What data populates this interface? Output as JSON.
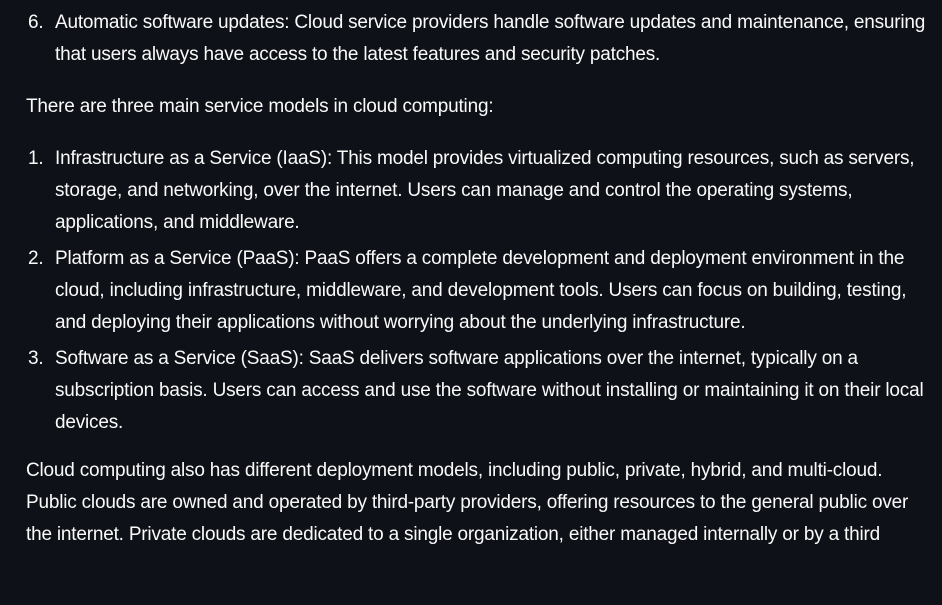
{
  "previous_list": {
    "items": [
      {
        "number": "6.",
        "text": "Automatic software updates: Cloud service providers handle software updates and maintenance, ensuring that users always have access to the latest features and security patches."
      }
    ]
  },
  "service_models": {
    "intro": "There are three main service models in cloud computing:",
    "items": [
      {
        "number": "1.",
        "text": "Infrastructure as a Service (IaaS): This model provides virtualized computing resources, such as servers, storage, and networking, over the internet. Users can manage and control the operating systems, applications, and middleware."
      },
      {
        "number": "2.",
        "text": "Platform as a Service (PaaS): PaaS offers a complete development and deployment environment in the cloud, including infrastructure, middleware, and development tools. Users can focus on building, testing, and deploying their applications without worrying about the underlying infrastructure."
      },
      {
        "number": "3.",
        "text": "Software as a Service (SaaS): SaaS delivers software applications over the internet, typically on a subscription basis. Users can access and use the software without installing or maintaining it on their local devices."
      }
    ]
  },
  "deployment_paragraph": "Cloud computing also has different deployment models, including public, private, hybrid, and multi-cloud. Public clouds are owned and operated by third-party providers, offering resources to the general public over the internet. Private clouds are dedicated to a single organization, either managed internally or by a third"
}
